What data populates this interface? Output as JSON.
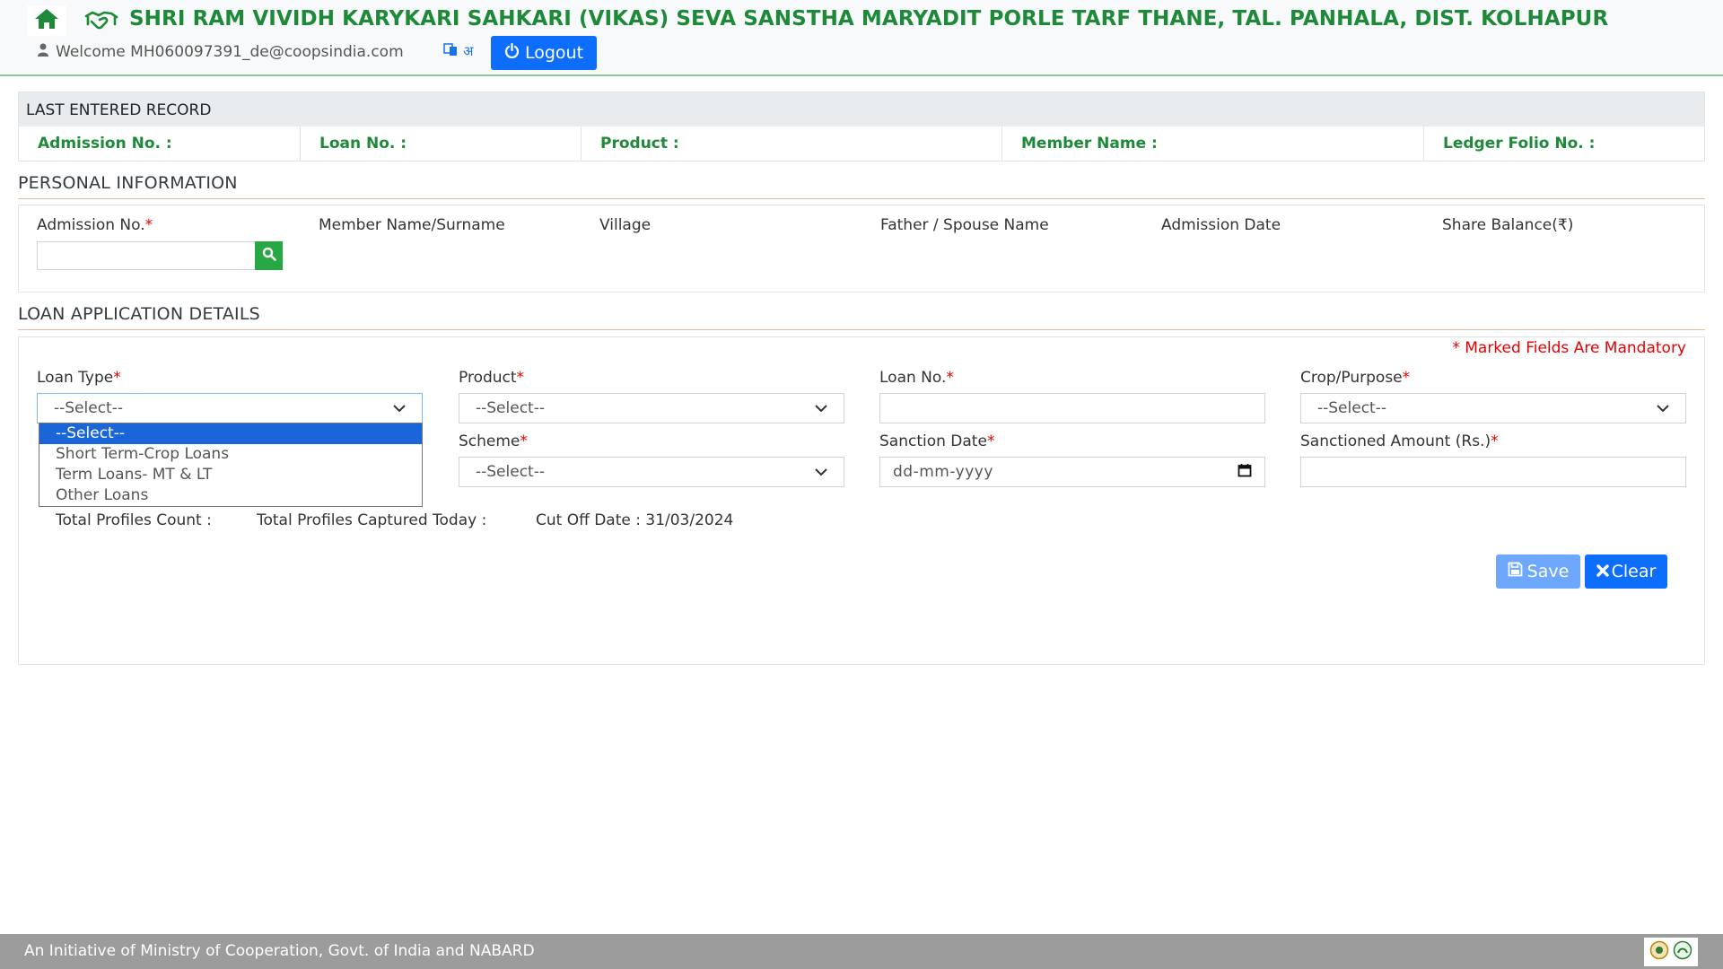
{
  "header": {
    "org_name": "SHRI RAM VIVIDH KARYKARI SAHKARI (VIKAS) SEVA SANSTHA MARYADIT PORLE TARF THANE, TAL. PANHALA, DIST. KOLHAPUR",
    "welcome": "Welcome MH060097391_de@coopsindia.com",
    "lang_label": "अ",
    "logout_label": "Logout",
    "brand_color": "#1e8a39"
  },
  "last_record": {
    "title": "LAST ENTERED RECORD",
    "fields": [
      "Admission No. :",
      "Loan No. :",
      "Product :",
      "Member Name :",
      "Ledger Folio No. :"
    ]
  },
  "personal": {
    "title": "PERSONAL INFORMATION",
    "admission_label": "Admission No.",
    "req_mark": "*",
    "member_label": "Member Name/Surname",
    "village_label": "Village",
    "father_label": "Father / Spouse Name",
    "admission_date_label": "Admission Date",
    "share_label": "Share Balance(₹)",
    "admission_value": ""
  },
  "loan": {
    "title": "LOAN APPLICATION DETAILS",
    "mandatory_note": "* Marked Fields Are Mandatory",
    "loan_type_label": "Loan Type",
    "loan_type_value": "--Select--",
    "loan_type_options": [
      "--Select--",
      "Short Term-Crop Loans",
      "Term Loans- MT & LT",
      "Other Loans"
    ],
    "product_label": "Product",
    "product_value": "--Select--",
    "loan_no_label": "Loan No.",
    "loan_no_value": "",
    "crop_label": "Crop/Purpose",
    "crop_value": "--Select--",
    "scheme_label": "Scheme",
    "scheme_value": "--Select--",
    "sanction_date_label": "Sanction Date",
    "sanction_date_placeholder": "dd-mm-yyyy",
    "sanctioned_amount_label": "Sanctioned Amount (Rs.)",
    "sanctioned_amount_value": "",
    "total_profiles": "Total Profiles Count :",
    "captured_today": "Total Profiles Captured Today :",
    "cutoff": "Cut Off Date : 31/03/2024",
    "save_label": "Save",
    "clear_label": "Clear"
  },
  "footer": {
    "text": "An Initiative of Ministry of Cooperation, Govt. of India and NABARD"
  }
}
